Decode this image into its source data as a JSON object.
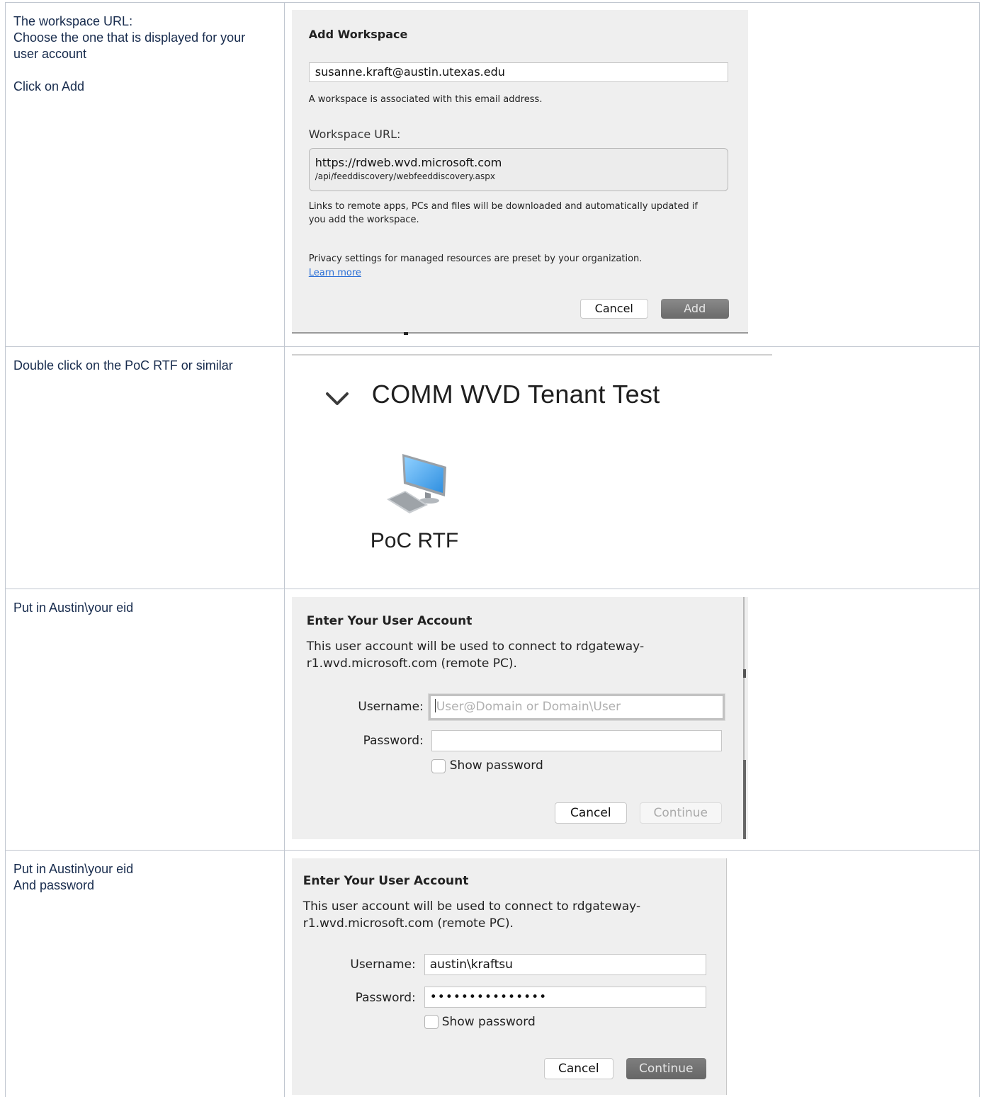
{
  "rows": [
    {
      "instructions": [
        "The workspace URL:",
        "Choose the one that is displayed for your",
        "user account",
        "",
        "Click on Add"
      ],
      "dialog": {
        "title": "Add Workspace",
        "email": "susanne.kraft@austin.utexas.edu",
        "associated": "A workspace is associated with this email address.",
        "url_label": "Workspace URL:",
        "url_line1": "https://rdweb.wvd.microsoft.com",
        "url_line2": "/api/feeddiscovery/webfeeddiscovery.aspx",
        "links_text": "Links to remote apps, PCs and files will be downloaded and automatically updated if you add the workspace.",
        "privacy_text": "Privacy settings for managed resources are preset by your organization.",
        "learn_more": "Learn more",
        "cancel": "Cancel",
        "add": "Add"
      }
    },
    {
      "instructions": [
        "Double click on the PoC RTF or similar"
      ],
      "workspace": {
        "tenant_name": "COMM WVD Tenant Test",
        "pc_name": "PoC RTF"
      }
    },
    {
      "instructions": [
        "Put in Austin\\your eid"
      ],
      "dialog": {
        "title": "Enter Your User Account",
        "description_line1": "This user account will be used to connect to rdgateway-",
        "description_line2": "r1.wvd.microsoft.com (remote PC).",
        "username_label": "Username:",
        "username_placeholder": "User@Domain or Domain\\User",
        "username_value": "",
        "password_label": "Password:",
        "password_value": "",
        "show_password": "Show password",
        "cancel": "Cancel",
        "continue": "Continue"
      }
    },
    {
      "instructions": [
        "Put in Austin\\your eid",
        "And password"
      ],
      "dialog": {
        "title": "Enter Your User Account",
        "description_line1": "This user account will be used to connect to rdgateway-",
        "description_line2": "r1.wvd.microsoft.com (remote PC).",
        "username_label": "Username:",
        "username_value": "austin\\kraftsu",
        "password_label": "Password:",
        "password_value": "•••••••••••••••",
        "show_password": "Show password",
        "cancel": "Cancel",
        "continue": "Continue"
      }
    }
  ],
  "colors": {
    "table_border": "#c1c7d0",
    "dialog_bg": "#efefef",
    "link": "#2b6fd6",
    "primary_button": "#6f6f6f"
  }
}
